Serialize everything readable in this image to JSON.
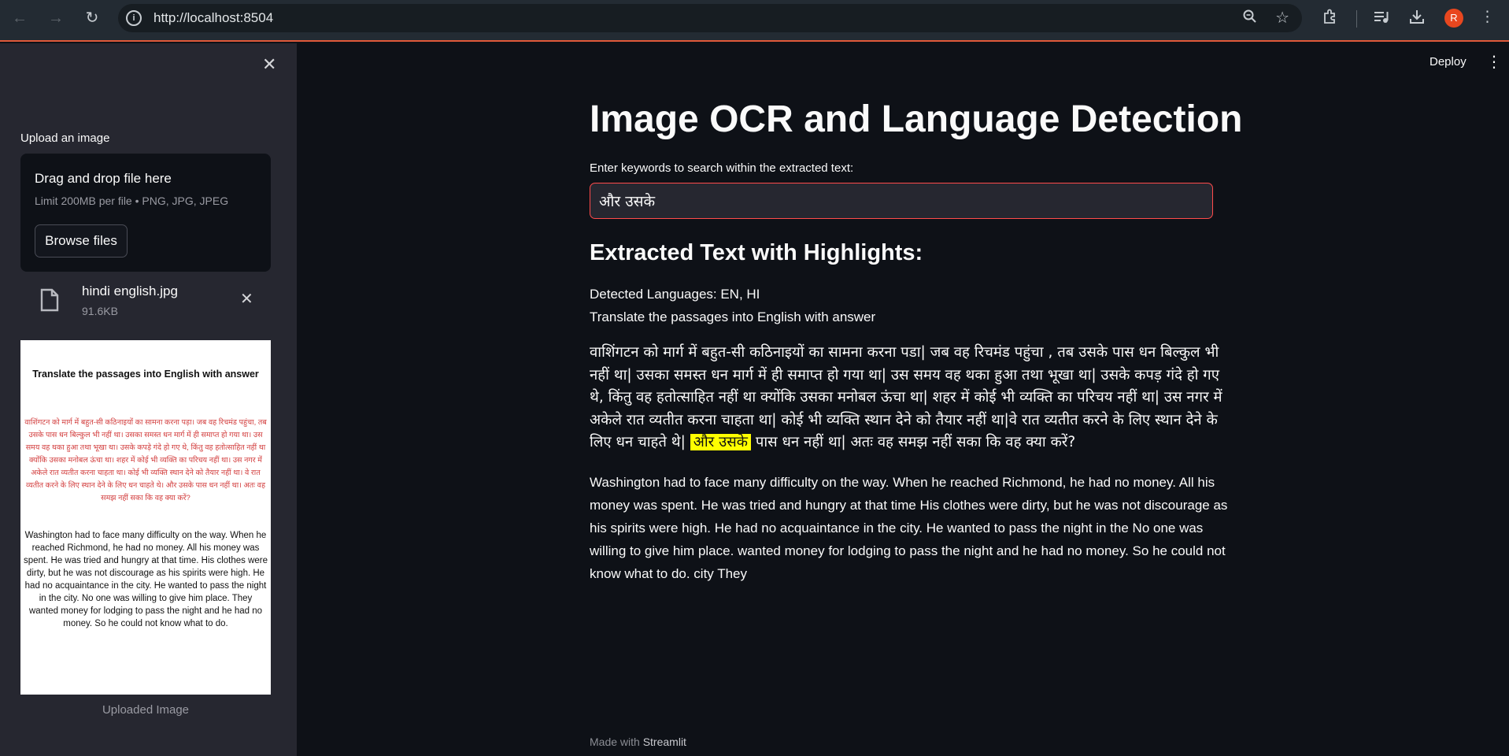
{
  "browser": {
    "url": "http://localhost:8504",
    "avatar_letter": "R"
  },
  "sidebar": {
    "upload_label": "Upload an image",
    "dropzone_title": "Drag and drop file here",
    "dropzone_limit": "Limit 200MB per file • PNG, JPG, JPEG",
    "browse_label": "Browse files",
    "file_name": "hindi english.jpg",
    "file_size": "91.6KB",
    "preview_caption": "Uploaded Image",
    "preview": {
      "title": "Translate the  passages into English with answer",
      "hindi": "वाशिंगटन को मार्ग में बहुत-सी कठिनाइयों का सामना करना पड़ा। जब वह रिचमंड पहुंचा, तब उसके पास धन बिल्कुल भी नहीं था। उसका समस्त धन मार्ग में ही समाप्त हो गया था। उस समय वह थका हुआ तथा भूखा था। उसके कपड़े गंदे हो गए थे, किंतु वह हतोत्साहित नहीं था क्योंकि उसका मनोबल ऊंचा था। शहर में कोई भी व्यक्ति का परिचय नहीं था। उस नगर में अकेले रात व्यतीत करना चाहता था। कोई भी व्यक्ति स्थान देने को तैयार नहीं  था। वे रात व्यतीत करने के लिए स्थान देने के लिए धन चाहते थे। और उसके पास धन नहीं था। अतः वह समझ नहीं सका कि वह क्या करें?",
      "english": "Washington had to face many difficulty on the way. When he reached Richmond, he had no money. All his money was spent. He was tried and hungry at that time. His clothes were dirty, but he was not discourage as his spirits were high. He had no acquaintance in the city. He wanted to pass the night in the city. No one was willing to give him place. They wanted money for lodging to pass the night and he had no money. So he could not know what to do."
    }
  },
  "header": {
    "deploy_label": "Deploy"
  },
  "main": {
    "title": "Image OCR and Language Detection",
    "keyword_label": "Enter keywords to search within the extracted text:",
    "keyword_value": "और उसके",
    "section_heading": "Extracted Text with Highlights:",
    "detected_languages": "Detected Languages: EN, HI",
    "first_line": "Translate the passages into English with answer",
    "hindi_before": "वाशिंगटन को मार्ग में बहुत-सी कठिनाइयों का सामना करना पडा| जब वह रिचमंड पहुंचा , तब उसके पास धन बिल्कुल भी नहीं था| उसका समस्त धन मार्ग में ही समाप्त हो गया था| उस समय वह थका हुआ तथा भूखा था| उसके कपड़ गंदे हो गए थे, किंतु वह हतोत्साहित नहीं था क्योंकि उसका मनोबल ऊंचा था| शहर में कोई भी व्यक्ति का परिचय नहीं था| उस नगर में अकेले रात व्यतीत करना चाहता था| कोई भी व्यक्ति स्थान देने को तैयार नहीं था|वे रात व्यतीत करने के लिए स्थान देने के लिए धन चाहते थे|",
    "hindi_highlight": "और उसके",
    "hindi_after": "पास धन नहीं था| अतः वह समझ नहीं सका कि वह क्या करें?",
    "english_para": "Washington had to face many difficulty on the way. When he reached Richmond, he had no money. All his money was spent. He was tried and hungry at that time His clothes were dirty, but he was not discourage as his spirits were high. He had no acquaintance in the city. He wanted to pass the night in the No one was willing to give him place. wanted money for lodging to pass the night and he had no money. So he could not know what to do. city They",
    "footer_prefix": "Made with",
    "footer_brand": "Streamlit"
  },
  "colors": {
    "background": "#0e1117",
    "sidebar": "#262730",
    "highlight": "#ffff00",
    "accent": "#ff4b4b"
  }
}
